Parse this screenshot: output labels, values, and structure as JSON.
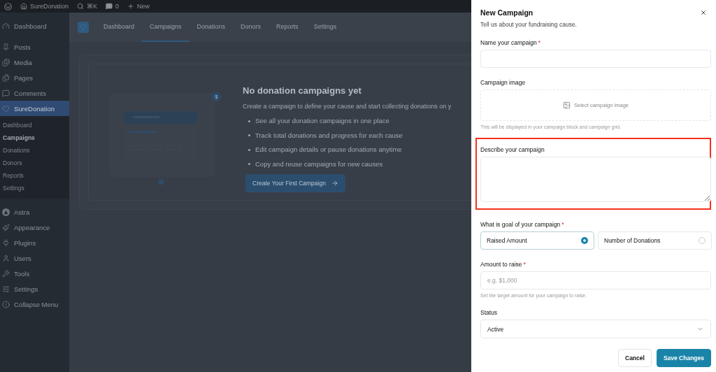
{
  "admin_bar": {
    "site": "SureDonation",
    "search_shortcut": "⌘K",
    "comments_count": "0",
    "new_label": "New"
  },
  "sidebar": {
    "items": [
      {
        "label": "Dashboard",
        "selected": false
      },
      {
        "label": "Posts",
        "selected": false
      },
      {
        "label": "Media",
        "selected": false
      },
      {
        "label": "Pages",
        "selected": false
      },
      {
        "label": "Comments",
        "selected": false
      },
      {
        "label": "SureDonation",
        "selected": true,
        "children": [
          {
            "label": "Dashboard",
            "selected": false
          },
          {
            "label": "Campaigns",
            "selected": true
          },
          {
            "label": "Donations",
            "selected": false
          },
          {
            "label": "Donors",
            "selected": false
          },
          {
            "label": "Reports",
            "selected": false
          },
          {
            "label": "Settings",
            "selected": false
          }
        ]
      },
      {
        "label": "Astra",
        "selected": false
      },
      {
        "label": "Appearance",
        "selected": false
      },
      {
        "label": "Plugins",
        "selected": false
      },
      {
        "label": "Users",
        "selected": false
      },
      {
        "label": "Tools",
        "selected": false
      },
      {
        "label": "Settings",
        "selected": false
      },
      {
        "label": "Collapse Menu",
        "selected": false
      }
    ]
  },
  "tabs": [
    {
      "label": "Dashboard",
      "selected": false
    },
    {
      "label": "Campaigns",
      "selected": true
    },
    {
      "label": "Donations",
      "selected": false
    },
    {
      "label": "Donors",
      "selected": false
    },
    {
      "label": "Reports",
      "selected": false
    },
    {
      "label": "Settings",
      "selected": false
    }
  ],
  "empty_state": {
    "badge": "$",
    "title": "No donation campaigns yet",
    "description": "Create a campaign to define your cause and start collecting donations on y",
    "bullets": [
      "See all your donation campaigns in one place",
      "Track total donations and progress for each cause",
      "Edit campaign details or pause donations anytime",
      "Copy and reuse campaigns for new causes"
    ],
    "button": "Create Your First Campaign"
  },
  "panel": {
    "title": "New Campaign",
    "subtitle": "Tell us about your fundraising cause.",
    "fields": [
      {
        "kind": "text",
        "label": "Name your campaign",
        "required_mark": "*"
      },
      {
        "kind": "image",
        "label": "Campaign image",
        "action": "Select campaign image",
        "hint": "This will be displayed in your campaign block and campaign grid."
      },
      {
        "kind": "textarea",
        "label": "Describe your campaign",
        "highlighted": true
      },
      {
        "kind": "radio",
        "label": "What is goal of your campaign",
        "required_mark": "*",
        "options": [
          {
            "label": "Raised Amount",
            "selected": true
          },
          {
            "label": "Number of Donations",
            "selected": false
          }
        ]
      },
      {
        "kind": "text",
        "label": "Amount to raise",
        "required_mark": "*",
        "placeholder": "e.g. $1,000",
        "hint": "Set the target amount for your campaign to raise."
      },
      {
        "kind": "select",
        "label": "Status",
        "value": "Active"
      }
    ],
    "buttons": [
      {
        "label": "Cancel",
        "kind": "secondary"
      },
      {
        "label": "Save Changes",
        "kind": "primary"
      }
    ]
  }
}
